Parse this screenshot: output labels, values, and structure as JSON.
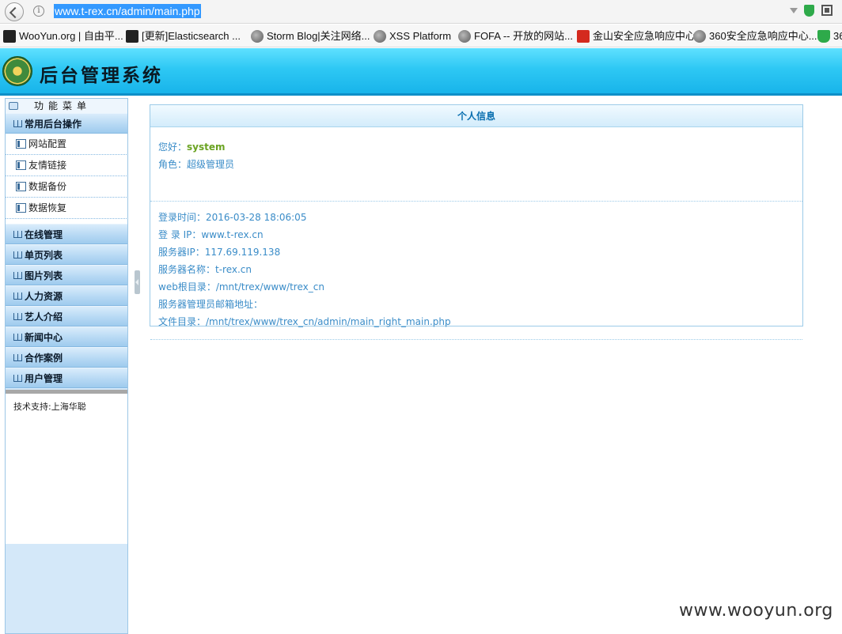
{
  "browser": {
    "url": "www.t-rex.cn/admin/main.php",
    "bookmarks": [
      {
        "label": "WooYun.org | 自由平...",
        "icon": "wooyun-icon"
      },
      {
        "label": "[更新]Elasticsearch ...",
        "icon": "wooyun-icon"
      },
      {
        "label": "Storm Blog|关注网络...",
        "icon": "globe-icon"
      },
      {
        "label": "XSS Platform",
        "icon": "globe-icon"
      },
      {
        "label": "FOFA -- 开放的网站...",
        "icon": "globe-icon"
      },
      {
        "label": "金山安全应急响应中心",
        "icon": "kingsoft-icon"
      },
      {
        "label": "360安全应急响应中心...",
        "icon": "globe-icon"
      },
      {
        "label": "36",
        "icon": "shield-icon"
      }
    ]
  },
  "header": {
    "title": "后台管理系统"
  },
  "sidebar": {
    "menu_title": "功能菜单",
    "active_group": {
      "label": "常用后台操作",
      "items": [
        "网站配置",
        "友情链接",
        "数据备份",
        "数据恢复"
      ]
    },
    "groups": [
      "在线管理",
      "单页列表",
      "图片列表",
      "人力资源",
      "艺人介绍",
      "新闻中心",
      "合作案例",
      "用户管理"
    ],
    "support": "技术支持:上海华聪"
  },
  "panel": {
    "title": "个人信息",
    "greeting_label": "您好：",
    "username": "system",
    "role": "角色：超级管理员",
    "rows": [
      "登录时间：2016-03-28 18:06:05",
      "登 录 IP：www.t-rex.cn",
      "服务器IP：117.69.119.138",
      "服务器名称：t-rex.cn",
      "web根目录：/mnt/trex/www/trex_cn",
      "服务器管理员邮箱地址：",
      "文件目录：/mnt/trex/www/trex_cn/admin/main_right_main.php"
    ]
  },
  "watermark": "www.wooyun.org"
}
